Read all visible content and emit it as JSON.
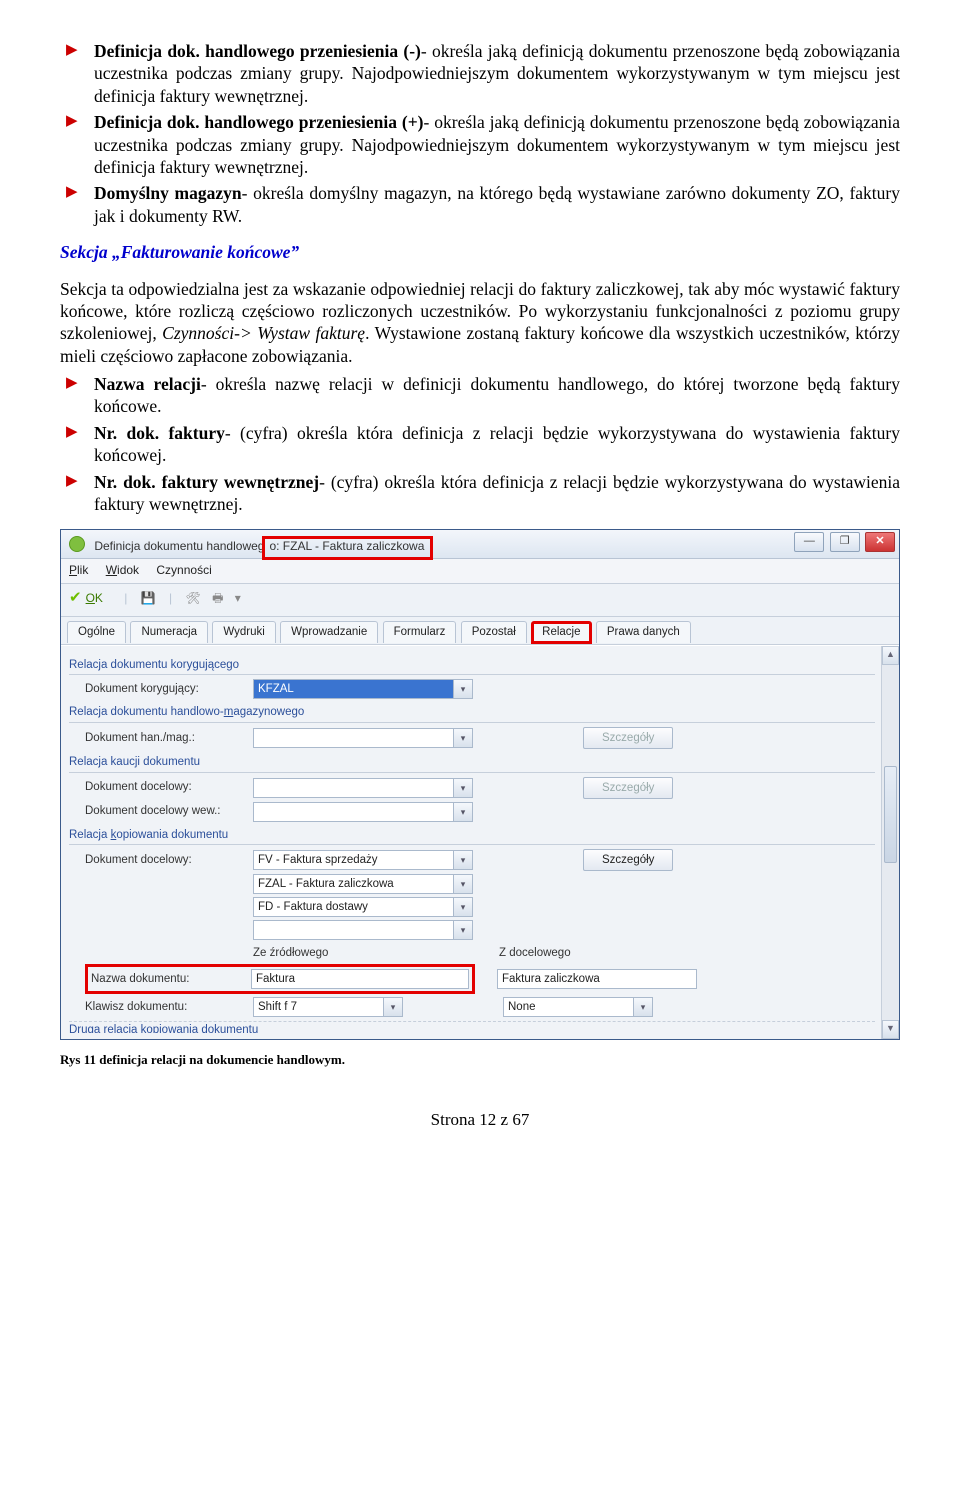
{
  "bullets1": {
    "b1a": "Definicja dok. handlowego przeniesienia (-)",
    "b1b": "- określa jaką definicją dokumentu przenoszone będą zobowiązania uczestnika podczas zmiany grupy. Najodpowiedniejszym dokumentem wykorzystywanym w tym miejscu jest definicja faktury wewnętrznej.",
    "b2a": "Definicja dok. handlowego przeniesienia (+)",
    "b2b": "- określa jaką definicją dokumentu przenoszone będą zobowiązania uczestnika podczas zmiany grupy. Najodpowiedniejszym dokumentem wykorzystywanym w tym miejscu jest definicja faktury wewnętrznej.",
    "b3a": "Domyślny magazyn",
    "b3b": "- określa domyślny magazyn, na którego będą wystawiane zarówno dokumenty ZO, faktury jak i dokumenty RW."
  },
  "section_title": "Sekcja „Fakturowanie końcowe”",
  "para": {
    "p1a": "Sekcja ta odpowiedzialna jest za wskazanie odpowiedniej relacji do faktury zaliczkowej, tak aby móc wystawić faktury końcowe, które rozliczą częściowo rozliczonych uczestników. Po wykorzystaniu funkcjonalności z poziomu grupy szkoleniowej, ",
    "p1b": "Czynności-> Wystaw fakturę",
    "p1c": ". Wystawione zostaną faktury końcowe dla wszystkich uczestników, którzy mieli częściowo zapłacone zobowiązania."
  },
  "bullets2": {
    "b1a": "Nazwa relacji",
    "b1b": "- określa nazwę relacji w definicji dokumentu handlowego, do której tworzone będą faktury końcowe.",
    "b2a": "Nr. dok. faktury",
    "b2b": "- (cyfra) określa która definicja z relacji będzie wykorzystywana do wystawienia faktury końcowej.",
    "b3a": "Nr. dok. faktury wewnętrznej",
    "b3b": "- (cyfra) określa która definicja z relacji będzie wykorzystywana do wystawienia faktury wewnętrznej."
  },
  "win": {
    "title_prefix": "Definicja dokumentu handloweg",
    "title_red": "o: FZAL - Faktura zaliczkowa",
    "menu": {
      "plik": "Plik",
      "widok": "Widok",
      "czyn": "Czynności"
    },
    "ok": "OK",
    "tabs": {
      "t1": "Ogólne",
      "t2": "Numeracja",
      "t3": "Wydruki",
      "t4": "Wprowadzanie",
      "t5": "Formularz",
      "t6": "Pozostał",
      "t7": "Relacje",
      "t8": "Prawa danych"
    },
    "g1": "Relacja dokumentu korygującego",
    "g1_label": "Dokument korygujący:",
    "g1_val": "KFZAL",
    "g2": "Relacja dokumentu handlowo-magazynowego",
    "g2_label": "Dokument han./mag.:",
    "g2_btn": "Szczegóły",
    "g3": "Relacja kaucji dokumentu",
    "g3a_label": "Dokument docelowy:",
    "g3a_btn": "Szczegóły",
    "g3b_label": "Dokument docelowy wew.:",
    "g4": "Relacja kopiowania dokumentu",
    "g4_label": "Dokument docelowy:",
    "g4_v1": "FV - Faktura sprzedaży",
    "g4_btn": "Szczegóły",
    "g4_v2": "FZAL - Faktura zaliczkowa",
    "g4_v3": "FD - Faktura dostawy",
    "colA": "Ze źródłowego",
    "colB": "Z docelowego",
    "nazwa_label": "Nazwa dokumentu:",
    "nazwa_valA": "Faktura",
    "nazwa_valB": "Faktura zaliczkowa",
    "klaw_label": "Klawisz dokumentu:",
    "klaw_valA": "Shift f 7",
    "klaw_valB": "None",
    "bottom_cut": "Druga relacja kopiowania dokumentu"
  },
  "caption": "Rys 11 definicja relacji na dokumencie handlowym.",
  "page": "Strona 12 z 67"
}
